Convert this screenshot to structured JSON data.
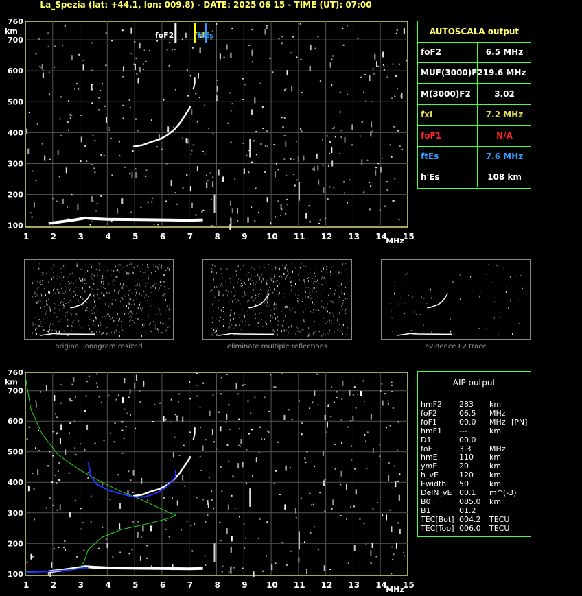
{
  "header": {
    "title": "La_Spezia (lat: +44.1, lon: 009.8) - DATE: 2025 06 15 - TIME (UT): 07:00"
  },
  "chart_data": [
    {
      "type": "scatter",
      "name_id": "ionogram-autoscala",
      "xlabel": "MHz",
      "ylabel": "km",
      "xlim": [
        1,
        15
      ],
      "ylim": [
        95,
        760
      ],
      "x_ticks": [
        "1",
        "2",
        "3",
        "4",
        "5",
        "6",
        "7",
        "8",
        "9",
        "10",
        "11",
        "12",
        "13",
        "14",
        "15"
      ],
      "y_ticks": [
        "100",
        "200",
        "300",
        "400",
        "500",
        "600",
        "700",
        "760"
      ],
      "grid": true,
      "markers": [
        {
          "label": "foF2",
          "x": 6.5,
          "color": "#ffffff"
        },
        {
          "label": "fxI",
          "x": 7.2,
          "color": "#ffff00"
        },
        {
          "label": "ftEs",
          "x": 7.6,
          "color": "#3399ff"
        }
      ],
      "traces": {
        "f2_trace": [
          [
            4.95,
            355
          ],
          [
            5.3,
            360
          ],
          [
            5.6,
            370
          ],
          [
            5.9,
            378
          ],
          [
            6.2,
            392
          ],
          [
            6.45,
            410
          ],
          [
            6.65,
            430
          ],
          [
            6.8,
            450
          ],
          [
            6.95,
            470
          ],
          [
            7.05,
            485
          ]
        ],
        "f2_upper": [
          [
            7.15,
            540
          ],
          [
            7.2,
            560
          ],
          [
            7.2,
            580
          ]
        ],
        "es_trace": [
          [
            1.85,
            107
          ],
          [
            2.3,
            112
          ],
          [
            2.8,
            118
          ],
          [
            3.2,
            124
          ],
          [
            3.5,
            122
          ],
          [
            4.0,
            120
          ],
          [
            5.0,
            119
          ],
          [
            6.0,
            118
          ],
          [
            7.0,
            117
          ],
          [
            7.5,
            118
          ]
        ]
      }
    },
    {
      "type": "line",
      "name_id": "ionogram-aip",
      "xlabel": "MHz",
      "ylabel": "km",
      "xlim": [
        1,
        15
      ],
      "ylim": [
        95,
        760
      ],
      "x_ticks": [
        "1",
        "2",
        "3",
        "4",
        "5",
        "6",
        "7",
        "8",
        "9",
        "10",
        "11",
        "12",
        "13",
        "14",
        "15"
      ],
      "y_ticks": [
        "100",
        "200",
        "300",
        "400",
        "500",
        "600",
        "700",
        "760"
      ],
      "grid": true,
      "series": [
        {
          "color": "#22dd22",
          "points": [
            [
              1.0,
              745
            ],
            [
              1.2,
              640
            ],
            [
              1.6,
              560
            ],
            [
              2.2,
              490
            ],
            [
              3.0,
              440
            ],
            [
              3.8,
              400
            ],
            [
              4.5,
              370
            ],
            [
              5.2,
              345
            ],
            [
              5.8,
              320
            ],
            [
              6.3,
              300
            ],
            [
              6.5,
              293
            ],
            [
              6.3,
              283
            ],
            [
              5.5,
              265
            ],
            [
              4.5,
              245
            ],
            [
              3.8,
              220
            ],
            [
              3.3,
              180
            ],
            [
              3.15,
              140
            ],
            [
              3.0,
              120
            ],
            [
              2.5,
              112
            ],
            [
              1.8,
              108
            ],
            [
              1.0,
              107
            ]
          ]
        },
        {
          "color": "#2233ff",
          "points": [
            [
              3.3,
              465
            ],
            [
              3.4,
              420
            ],
            [
              3.6,
              395
            ],
            [
              4.0,
              375
            ],
            [
              4.6,
              360
            ],
            [
              5.0,
              352
            ],
            [
              5.4,
              353
            ],
            [
              5.8,
              365
            ],
            [
              6.1,
              380
            ],
            [
              6.3,
              398
            ],
            [
              6.5,
              418
            ],
            [
              6.5,
              440
            ]
          ]
        },
        {
          "color": "#2233ff",
          "points": [
            [
              1.0,
              105
            ],
            [
              1.8,
              108
            ],
            [
              2.5,
              112
            ],
            [
              3.0,
              118
            ],
            [
              3.3,
              122
            ]
          ]
        }
      ],
      "traces": {
        "f2_trace": [
          [
            4.95,
            355
          ],
          [
            5.3,
            360
          ],
          [
            5.6,
            370
          ],
          [
            5.9,
            378
          ],
          [
            6.2,
            392
          ],
          [
            6.45,
            410
          ],
          [
            6.65,
            430
          ],
          [
            6.8,
            450
          ],
          [
            6.95,
            470
          ],
          [
            7.05,
            485
          ]
        ],
        "f2_upper": [
          [
            7.15,
            540
          ],
          [
            7.2,
            560
          ],
          [
            7.2,
            580
          ]
        ],
        "es_trace": [
          [
            1.85,
            107
          ],
          [
            2.3,
            112
          ],
          [
            2.8,
            118
          ],
          [
            3.2,
            124
          ],
          [
            3.5,
            122
          ],
          [
            4.0,
            120
          ],
          [
            5.0,
            119
          ],
          [
            6.0,
            118
          ],
          [
            7.0,
            117
          ],
          [
            7.5,
            118
          ]
        ]
      }
    }
  ],
  "autoscala": {
    "title": "AUTOSCALA output",
    "rows": [
      {
        "label": "foF2",
        "value": "6.5 MHz",
        "color": "#ffffff"
      },
      {
        "label": "MUF(3000)F2",
        "value": "19.6 MHz",
        "color": "#ffffff"
      },
      {
        "label": "M(3000)F2",
        "value": "3.02",
        "color": "#ffffff"
      },
      {
        "label": "fxI",
        "value": "7.2 MHz",
        "color": "#dddd55"
      },
      {
        "label": "foF1",
        "value": "N/A",
        "color": "#ff2222"
      },
      {
        "label": "ftEs",
        "value": "7.6 MHz",
        "color": "#3399ff"
      },
      {
        "label": "h'Es",
        "value": "108     km",
        "color": "#ffffff"
      }
    ]
  },
  "thumbnails": {
    "captions": [
      "original ionogram resized",
      "eliminate multiple reflections",
      "evidence F2 trace"
    ]
  },
  "aip": {
    "title": "AIP output",
    "rows": [
      {
        "param": "hmF2",
        "value": "283",
        "unit": "km",
        "extra": ""
      },
      {
        "param": "foF2",
        "value": "06.5",
        "unit": "MHz",
        "extra": ""
      },
      {
        "param": "foF1",
        "value": "00.0",
        "unit": "MHz",
        "extra": "[PN]"
      },
      {
        "param": "hmF1",
        "value": "---",
        "unit": "km",
        "extra": ""
      },
      {
        "param": "D1",
        "value": "00.0",
        "unit": "",
        "extra": ""
      },
      {
        "param": "foE",
        "value": "3.3",
        "unit": "MHz",
        "extra": ""
      },
      {
        "param": "hmE",
        "value": "110",
        "unit": "km",
        "extra": ""
      },
      {
        "param": "ymE",
        "value": "20",
        "unit": "km",
        "extra": ""
      },
      {
        "param": "h_vE",
        "value": "120",
        "unit": "km",
        "extra": ""
      },
      {
        "param": "Ewidth",
        "value": "50",
        "unit": "km",
        "extra": ""
      },
      {
        "param": "DelN_vE",
        "value": "00.1",
        "unit": "m^(-3)",
        "extra": ""
      },
      {
        "param": "B0",
        "value": "085.0",
        "unit": "km",
        "extra": ""
      },
      {
        "param": "B1",
        "value": "01.2",
        "unit": "",
        "extra": ""
      },
      {
        "param": "TEC[Bot]",
        "value": "004.2",
        "unit": "TECU",
        "extra": ""
      },
      {
        "param": "TEC[Top]",
        "value": "006.0",
        "unit": "TECU",
        "extra": ""
      }
    ]
  }
}
